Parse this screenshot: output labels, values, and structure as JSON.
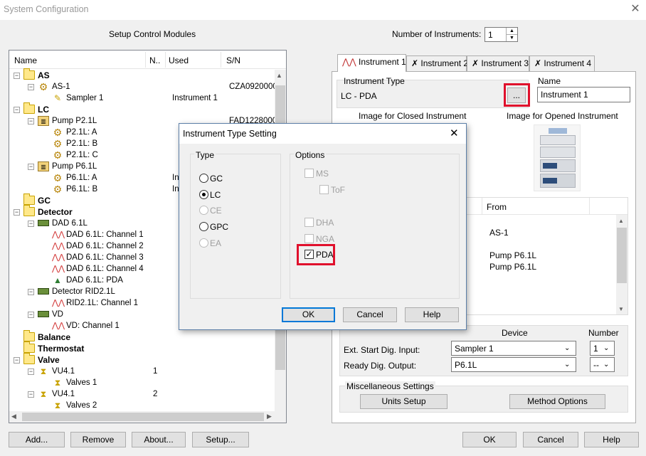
{
  "window": {
    "title": "System Configuration",
    "close_glyph": "✕"
  },
  "left": {
    "heading": "Setup Control Modules",
    "columns": [
      "Name",
      "N..",
      "Used",
      "S/N"
    ],
    "tree": [
      {
        "label": "AS",
        "level": 0,
        "icon": "folder-icon",
        "bold": true,
        "exp": "−"
      },
      {
        "label": "AS-1",
        "level": 1,
        "icon": "gear-icon",
        "exp": "−",
        "sn": "CZA0920000"
      },
      {
        "label": "Sampler 1",
        "level": 2,
        "icon": "pen-icon",
        "used": "Instrument 1"
      },
      {
        "label": "LC",
        "level": 0,
        "icon": "folder-icon",
        "bold": true,
        "exp": "−"
      },
      {
        "label": "Pump P2.1L",
        "level": 1,
        "icon": "pump-icon",
        "exp": "−",
        "sn": "FAD1228000"
      },
      {
        "label": "P2.1L: A",
        "level": 2,
        "icon": "gear-icon"
      },
      {
        "label": "P2.1L: B",
        "level": 2,
        "icon": "gear-icon"
      },
      {
        "label": "P2.1L: C",
        "level": 2,
        "icon": "gear-icon"
      },
      {
        "label": "Pump P6.1L",
        "level": 1,
        "icon": "pump-icon",
        "exp": "−"
      },
      {
        "label": "P6.1L: A",
        "level": 2,
        "icon": "gear-icon",
        "used": "In"
      },
      {
        "label": "P6.1L: B",
        "level": 2,
        "icon": "gear-icon",
        "used": "In"
      },
      {
        "label": "GC",
        "level": 0,
        "icon": "folder-icon",
        "bold": true
      },
      {
        "label": "Detector",
        "level": 0,
        "icon": "folder-icon",
        "bold": true,
        "exp": "−"
      },
      {
        "label": "DAD 6.1L",
        "level": 1,
        "icon": "detector-icon",
        "exp": "−"
      },
      {
        "label": "DAD 6.1L: Channel 1",
        "level": 2,
        "icon": "channel-icon"
      },
      {
        "label": "DAD 6.1L: Channel 2",
        "level": 2,
        "icon": "channel-icon"
      },
      {
        "label": "DAD 6.1L: Channel 3",
        "level": 2,
        "icon": "channel-icon"
      },
      {
        "label": "DAD 6.1L: Channel 4",
        "level": 2,
        "icon": "channel-icon"
      },
      {
        "label": "DAD 6.1L: PDA",
        "level": 2,
        "icon": "pda-icon"
      },
      {
        "label": "Detector RID2.1L",
        "level": 1,
        "icon": "detector-icon",
        "exp": "−"
      },
      {
        "label": "RID2.1L: Channel 1",
        "level": 2,
        "icon": "channel-icon"
      },
      {
        "label": "VD",
        "level": 1,
        "icon": "detector-icon",
        "exp": "−"
      },
      {
        "label": "VD: Channel 1",
        "level": 2,
        "icon": "channel-icon"
      },
      {
        "label": "Balance",
        "level": 0,
        "icon": "folder-icon",
        "bold": true
      },
      {
        "label": "Thermostat",
        "level": 0,
        "icon": "folder-icon",
        "bold": true
      },
      {
        "label": "Valve",
        "level": 0,
        "icon": "folder-icon",
        "bold": true,
        "exp": "−"
      },
      {
        "label": "VU4.1",
        "level": 1,
        "icon": "valve-icon",
        "exp": "−",
        "n": "1"
      },
      {
        "label": "Valves 1",
        "level": 2,
        "icon": "valve-icon"
      },
      {
        "label": "VU4.1",
        "level": 1,
        "icon": "valve-icon",
        "exp": "−",
        "n": "2"
      },
      {
        "label": "Valves 2",
        "level": 2,
        "icon": "valve-icon"
      }
    ],
    "buttons": {
      "add": "Add...",
      "remove": "Remove",
      "about": "About...",
      "setup": "Setup..."
    }
  },
  "right": {
    "num_instruments_label": "Number of Instruments:",
    "num_instruments_value": "1",
    "tabs": [
      "Instrument 1",
      "Instrument 2",
      "Instrument 3",
      "Instrument 4"
    ],
    "instrument_type_label": "Instrument Type",
    "instrument_type_value": "LC - PDA",
    "browse_label": "...",
    "name_label": "Name",
    "name_value": "Instrument 1",
    "image_closed_label": "Image for Closed Instrument",
    "image_opened_label": "Image for Opened Instrument",
    "from_header": "From",
    "from_rows": [
      "AS-1",
      "",
      "Pump P6.1L",
      "Pump P6.1L"
    ],
    "device_header": "Device",
    "number_header": "Number",
    "ext_start_label": "Ext. Start Dig. Input:",
    "ext_start_device": "Sampler 1",
    "ext_start_number": "1",
    "ready_label": "Ready Dig. Output:",
    "ready_device": "P6.1L",
    "ready_number": "--",
    "misc_label": "Miscellaneous Settings",
    "units_setup": "Units Setup",
    "method_options": "Method Options"
  },
  "footer": {
    "ok": "OK",
    "cancel": "Cancel",
    "help": "Help"
  },
  "dialog": {
    "title": "Instrument Type Setting",
    "type_label": "Type",
    "types": [
      {
        "label": "GC",
        "selected": false,
        "enabled": true
      },
      {
        "label": "LC",
        "selected": true,
        "enabled": true
      },
      {
        "label": "CE",
        "selected": false,
        "enabled": false
      },
      {
        "label": "GPC",
        "selected": false,
        "enabled": true
      },
      {
        "label": "EA",
        "selected": false,
        "enabled": false
      }
    ],
    "options_label": "Options",
    "options": [
      {
        "label": "MS",
        "checked": false
      },
      {
        "label": "ToF",
        "checked": false
      },
      {
        "label": "DHA",
        "checked": false
      },
      {
        "label": "NGA",
        "checked": false
      },
      {
        "label": "PDA",
        "checked": true
      }
    ],
    "ok": "OK",
    "cancel": "Cancel",
    "help": "Help"
  },
  "colors": {
    "highlight": "#e0102c",
    "focus": "#0078d7"
  }
}
